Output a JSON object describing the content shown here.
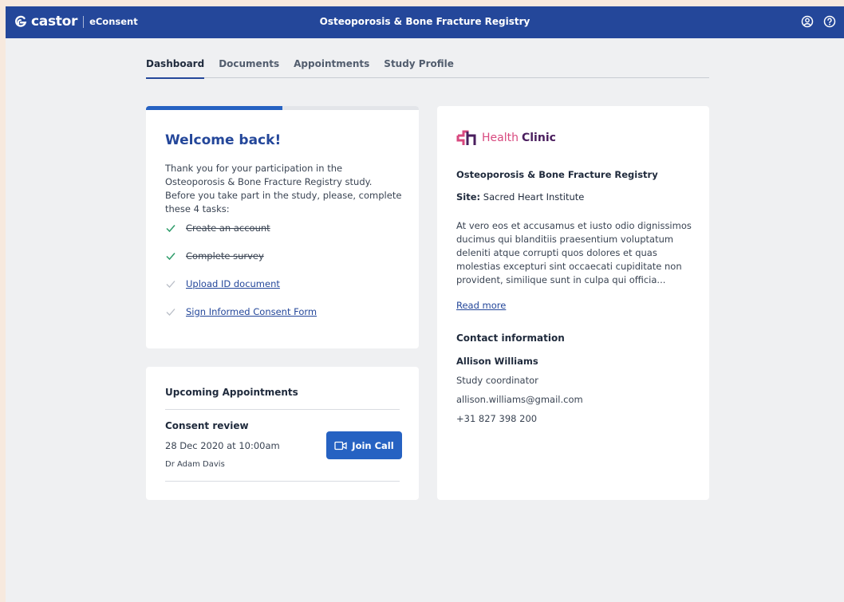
{
  "header": {
    "brand_name": "castor",
    "brand_product": "eConsent",
    "title": "Osteoporosis & Bone Fracture Registry",
    "icons": [
      "user-circle-icon",
      "help-icon"
    ]
  },
  "tabs": [
    {
      "label": "Dashboard",
      "active": true
    },
    {
      "label": "Documents",
      "active": false
    },
    {
      "label": "Appointments",
      "active": false
    },
    {
      "label": "Study Profile",
      "active": false
    }
  ],
  "welcome": {
    "progress": 0.5,
    "title": "Welcome back!",
    "intro": "Thank you for your participation in the Osteoporosis & Bone Fracture Registry study. Before you take part in the study, please, complete these 4 tasks:",
    "tasks": [
      {
        "label": "Create an account",
        "done": true
      },
      {
        "label": "Complete survey",
        "done": true
      },
      {
        "label": "Upload ID document",
        "done": false
      },
      {
        "label": "Sign Informed Consent Form",
        "done": false
      }
    ]
  },
  "appointments": {
    "heading": "Upcoming Appointments",
    "item": {
      "name": "Consent review",
      "datetime": "28 Dec 2020 at 10:00am",
      "doctor": "Dr Adam Davis",
      "button_label": "Join Call"
    }
  },
  "clinic": {
    "logo_word1": "Health",
    "logo_word2": "Clinic",
    "study": "Osteoporosis & Bone Fracture Registry",
    "site_label": "Site:",
    "site_value": "Sacred Heart Institute",
    "description": "At vero eos et accusamus et iusto odio dignissimos ducimus qui blanditiis praesentium voluptatum deleniti atque corrupti quos dolores et quas molestias excepturi sint occaecati cupiditate non provident, similique sunt in culpa qui officia...",
    "read_more": "Read more",
    "contact_heading": "Contact information",
    "contact_name": "Allison Williams",
    "contact_role": "Study coordinator",
    "contact_email": "allison.williams@gmail.com",
    "contact_phone": "+31 827 398 200"
  },
  "colors": {
    "header_bg": "#24479a",
    "accent": "#2662c2",
    "check_done": "#2e9c6a",
    "check_pending": "#b9bec7",
    "clinic_pink": "#d8497f",
    "clinic_purple": "#4a1e5e"
  }
}
